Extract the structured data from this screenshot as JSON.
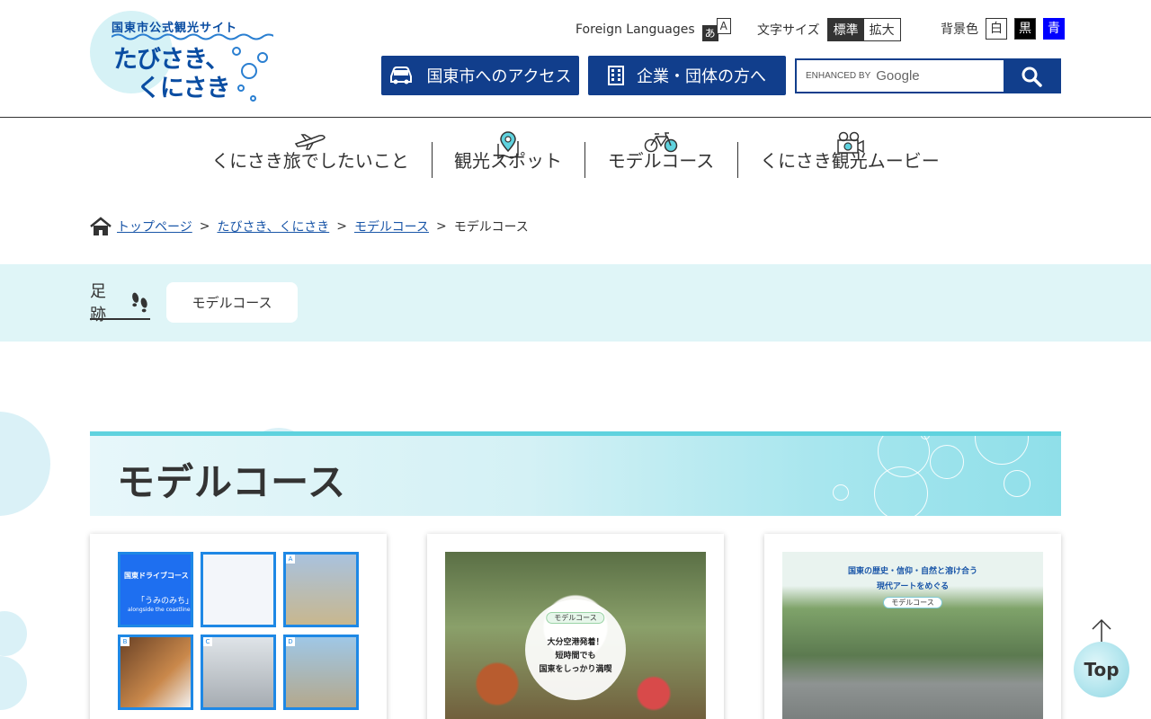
{
  "logo": {
    "small": "国東市公式観光サイト",
    "line1": "たびさき、",
    "line2": "くにさき"
  },
  "utility": {
    "foreign_languages": "Foreign Languages",
    "lang_icon_a1": "あ",
    "lang_icon_a2": "A",
    "text_size_label": "文字サイズ",
    "text_size_standard": "標準",
    "text_size_large": "拡大",
    "bg_color_label": "背景色",
    "bg_white": "白",
    "bg_black": "黒",
    "bg_blue": "青"
  },
  "header_buttons": {
    "access": "国東市へのアクセス",
    "corporate": "企業・団体の方へ"
  },
  "search": {
    "enhanced": "ENHANCED BY",
    "google": "Google"
  },
  "nav": [
    {
      "label": "くにさき旅でしたいこと",
      "icon": "airplane-icon"
    },
    {
      "label": "観光スポット",
      "icon": "map-pin-icon"
    },
    {
      "label": "モデルコース",
      "icon": "bicycle-icon"
    },
    {
      "label": "くにさき観光ムービー",
      "icon": "movie-camera-icon"
    }
  ],
  "breadcrumb": {
    "home": "トップページ",
    "level1": "たびさき、くにさき",
    "level2": "モデルコース",
    "current": "モデルコース",
    "sep": ">"
  },
  "footprint": {
    "label": "足跡",
    "chip": "モデルコース"
  },
  "page_title": "モデルコース",
  "cards": {
    "card1": {
      "tiles": [
        {
          "letter": "",
          "title": "国東ドライブコース",
          "sub": "「うみのみち」",
          "sub2": "alongside the coastline"
        },
        {
          "letter": "",
          "title": "",
          "sub": "",
          "sub2": ""
        },
        {
          "letter": "A",
          "title": "",
          "sub": "",
          "sub2": ""
        },
        {
          "letter": "B",
          "title": "",
          "sub": "",
          "sub2": ""
        },
        {
          "letter": "C",
          "title": "",
          "sub": "",
          "sub2": ""
        },
        {
          "letter": "D",
          "title": "",
          "sub": "",
          "sub2": ""
        }
      ]
    },
    "card2": {
      "tag": "モデルコース",
      "line1": "大分空港発着！",
      "line2": "短時間でも",
      "line3": "国東をしっかり満喫"
    },
    "card3": {
      "line1": "国東の歴史・信仰・自然と溶け合う",
      "line2": "現代アートをめぐる",
      "tag": "モデルコース"
    }
  },
  "top_button": "Top",
  "colors": {
    "brand_navy": "#113e8c",
    "logo_blue": "#0a4da2",
    "link_blue": "#1a56a8",
    "light_cyan": "#dff5f7",
    "accent_cyan": "#5fd2de"
  }
}
